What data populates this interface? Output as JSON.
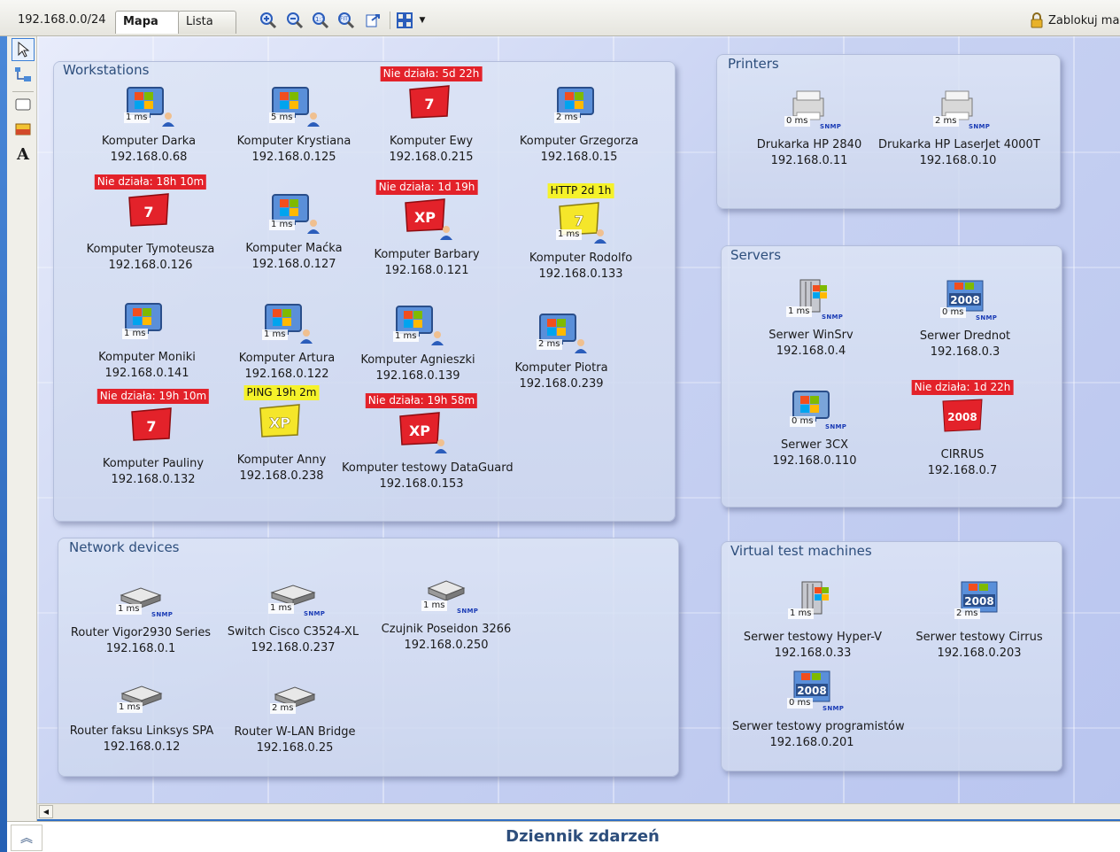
{
  "toolbar": {
    "subnet": "192.168.0.0/24",
    "tab_map": "Mapa",
    "tab_list": "Lista",
    "lock_map": "Zablokuj map"
  },
  "groups": {
    "workstations": "Workstations",
    "printers": "Printers",
    "servers": "Servers",
    "network": "Network devices",
    "virtual": "Virtual test machines"
  },
  "devices": [
    {
      "name": "Komputer Darka",
      "ip": "192.168.0.68",
      "ms": "1 ms",
      "icon": "win7-user-icon"
    },
    {
      "name": "Komputer Krystiana",
      "ip": "192.168.0.125",
      "ms": "5 ms",
      "icon": "win7-user-icon"
    },
    {
      "name": "Komputer Ewy",
      "ip": "192.168.0.215",
      "badge": "Nie działa: 5d 22h",
      "icon": "win7-down-icon"
    },
    {
      "name": "Komputer Grzegorza",
      "ip": "192.168.0.15",
      "ms": "2 ms",
      "icon": "win7-icon"
    },
    {
      "name": "Komputer Tymoteusza",
      "ip": "192.168.0.126",
      "badge": "Nie działa: 18h 10m",
      "icon": "win7-down-icon"
    },
    {
      "name": "Komputer Maćka",
      "ip": "192.168.0.127",
      "ms": "1 ms",
      "icon": "win7-user-icon"
    },
    {
      "name": "Komputer Barbary",
      "ip": "192.168.0.121",
      "badge": "Nie działa: 1d 19h",
      "icon": "winxp-down-user-icon"
    },
    {
      "name": "Komputer Rodolfo",
      "ip": "192.168.0.133",
      "badge": "HTTP 2d 1h",
      "ms": "1 ms",
      "icon": "win7-warn-user-icon"
    },
    {
      "name": "Komputer Moniki",
      "ip": "192.168.0.141",
      "ms": "1 ms",
      "icon": "win7-icon"
    },
    {
      "name": "Komputer Artura",
      "ip": "192.168.0.122",
      "ms": "1 ms",
      "icon": "win7-user-icon"
    },
    {
      "name": "Komputer Agnieszki",
      "ip": "192.168.0.139",
      "ms": "1 ms",
      "icon": "win7-user-icon"
    },
    {
      "name": "Komputer Piotra",
      "ip": "192.168.0.239",
      "ms": "2 ms",
      "icon": "win7-user-icon"
    },
    {
      "name": "Komputer Pauliny",
      "ip": "192.168.0.132",
      "badge": "Nie działa: 19h 10m",
      "icon": "win7-down-icon"
    },
    {
      "name": "Komputer Anny",
      "ip": "192.168.0.238",
      "badge": "PING 19h 2m",
      "icon": "winxp-warn-icon"
    },
    {
      "name": "Komputer testowy DataGuard",
      "ip": "192.168.0.153",
      "badge": "Nie działa: 19h 58m",
      "icon": "winxp-down-user-icon"
    },
    {
      "name": "Drukarka HP 2840",
      "ip": "192.168.0.11",
      "ms": "0 ms",
      "snmp": "SNMP",
      "icon": "printer-icon"
    },
    {
      "name": "Drukarka HP LaserJet 4000T",
      "ip": "192.168.0.10",
      "ms": "2 ms",
      "snmp": "SNMP",
      "icon": "printer-icon"
    },
    {
      "name": "Serwer WinSrv",
      "ip": "192.168.0.4",
      "ms": "1 ms",
      "snmp": "SNMP",
      "icon": "server-tower-icon"
    },
    {
      "name": "Serwer Drednot",
      "ip": "192.168.0.3",
      "ms": "0 ms",
      "snmp": "SNMP",
      "icon": "server-2008-icon"
    },
    {
      "name": "Serwer 3CX",
      "ip": "192.168.0.110",
      "ms": "0 ms",
      "snmp": "SNMP",
      "icon": "winxp-icon"
    },
    {
      "name": "CIRRUS",
      "ip": "192.168.0.7",
      "badge": "Nie działa: 1d 22h",
      "icon": "server-2008-down-icon"
    },
    {
      "name": "Router Vigor2930 Series",
      "ip": "192.168.0.1",
      "ms": "1 ms",
      "snmp": "SNMP",
      "icon": "router-icon"
    },
    {
      "name": "Switch Cisco C3524-XL",
      "ip": "192.168.0.237",
      "ms": "1 ms",
      "snmp": "SNMP",
      "icon": "switch-icon"
    },
    {
      "name": "Czujnik Poseidon 3266",
      "ip": "192.168.0.250",
      "ms": "1 ms",
      "snmp": "SNMP",
      "icon": "sensor-icon"
    },
    {
      "name": "Router faksu Linksys SPA",
      "ip": "192.168.0.12",
      "ms": "1 ms",
      "icon": "router-icon"
    },
    {
      "name": "Router W-LAN Bridge",
      "ip": "192.168.0.25",
      "ms": "2 ms",
      "icon": "router-icon"
    },
    {
      "name": "Serwer testowy Hyper-V",
      "ip": "192.168.0.33",
      "ms": "1 ms",
      "icon": "server-tower-icon"
    },
    {
      "name": "Serwer testowy Cirrus",
      "ip": "192.168.0.203",
      "ms": "2 ms",
      "icon": "server-2008-icon"
    },
    {
      "name": "Serwer testowy programistów",
      "ip": "192.168.0.201",
      "ms": "0 ms",
      "snmp": "SNMP",
      "icon": "server-2008-icon"
    }
  ],
  "bottom": {
    "log_title": "Dziennik zdarzeń"
  },
  "colors": {
    "down": "#e3222a",
    "warn": "#f5f22a",
    "title": "#2d4e7c"
  }
}
